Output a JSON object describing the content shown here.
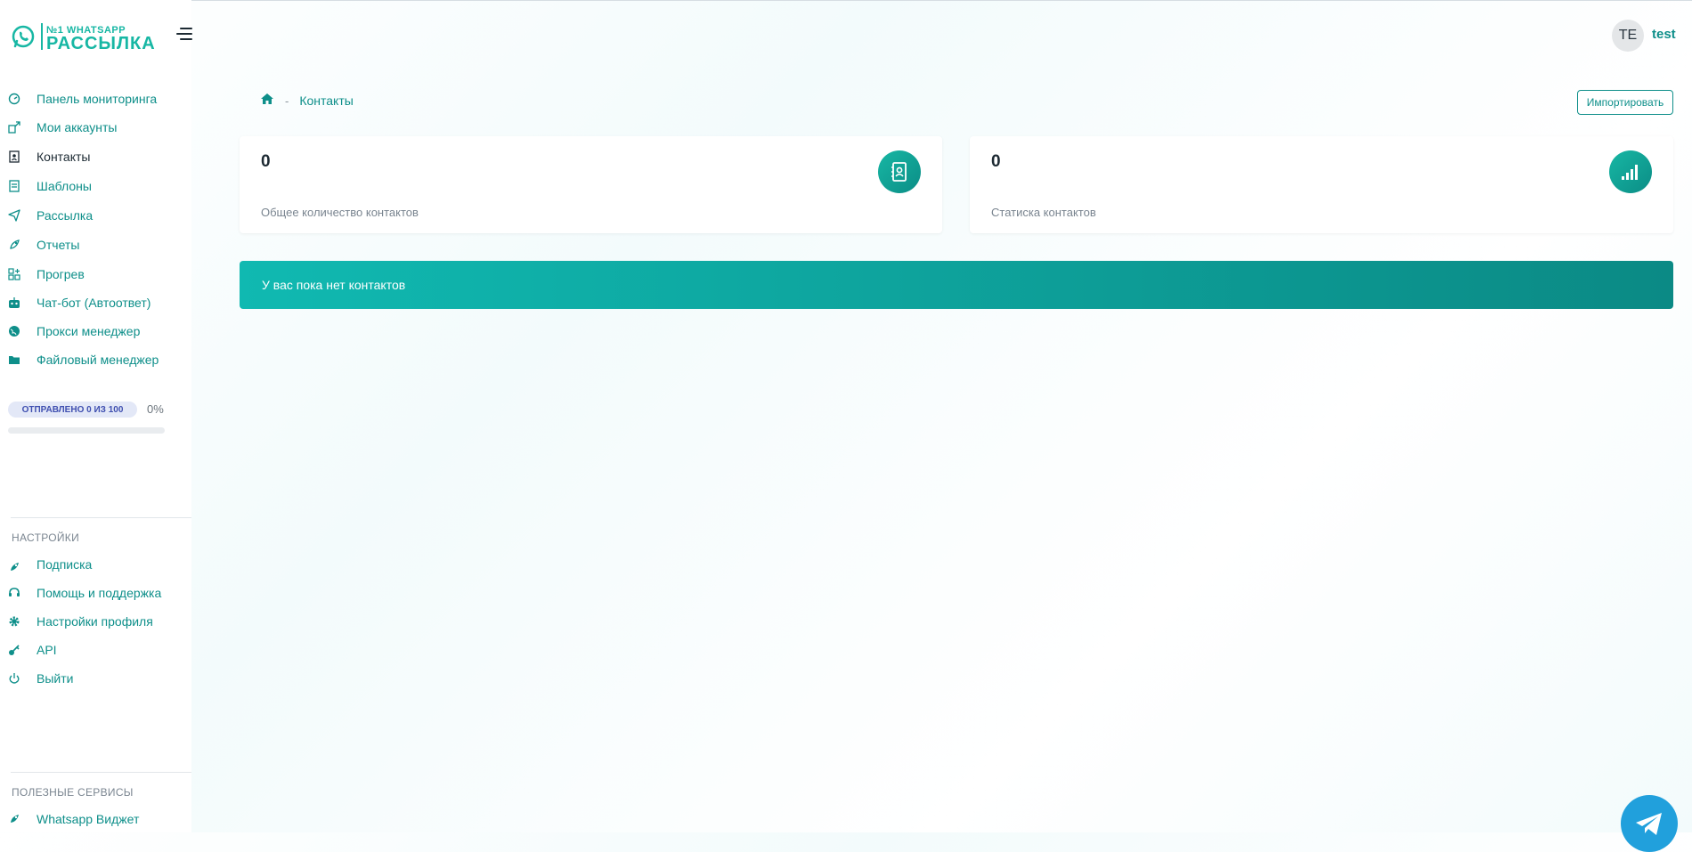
{
  "app": {
    "logo_top": "№1 WHATSAPP",
    "logo_main": "РАССЫЛКА"
  },
  "user": {
    "initials": "TE",
    "name": "test"
  },
  "sidebar": {
    "items": [
      {
        "label": "Панель мониторинга",
        "icon": "gauge-icon"
      },
      {
        "label": "Мои аккаунты",
        "icon": "accounts-icon"
      },
      {
        "label": "Контакты",
        "icon": "contact-book-icon"
      },
      {
        "label": "Шаблоны",
        "icon": "template-icon"
      },
      {
        "label": "Рассылка",
        "icon": "send-icon"
      },
      {
        "label": "Отчеты",
        "icon": "rocket-icon"
      },
      {
        "label": "Прогрев",
        "icon": "grid-plus-icon"
      },
      {
        "label": "Чат-бот (Автоответ)",
        "icon": "robot-icon"
      },
      {
        "label": "Прокси менеджер",
        "icon": "globe-icon"
      },
      {
        "label": "Файловый менеджер",
        "icon": "folder-icon"
      }
    ],
    "sent_badge": "ОТПРАВЛЕНО 0 ИЗ 100",
    "sent_percent": "0%",
    "sent_progress": 0,
    "settings_title": "НАСТРОЙКИ",
    "settings_items": [
      {
        "label": "Подписка",
        "icon": "rocket-icon"
      },
      {
        "label": "Помощь и поддержка",
        "icon": "headset-icon"
      },
      {
        "label": "Настройки профиля",
        "icon": "gear-icon"
      },
      {
        "label": "API",
        "icon": "key-icon"
      },
      {
        "label": "Выйти",
        "icon": "power-icon"
      }
    ],
    "services_title": "ПОЛЕЗНЫЕ СЕРВИСЫ",
    "services_items": [
      {
        "label": "Whatsapp Виджет",
        "icon": "rocket-icon"
      }
    ]
  },
  "breadcrumb": {
    "current": "Контакты",
    "separator": "-"
  },
  "import_button": "Импортировать",
  "cards": [
    {
      "value": "0",
      "label": "Общее количество контактов",
      "icon": "contact-book-icon"
    },
    {
      "value": "0",
      "label": "Статиска контактов",
      "icon": "signal-bars-icon"
    }
  ],
  "alert": "У вас пока нет контактов",
  "colors": {
    "accent": "#0e8f8a",
    "accent_light": "#17b7a4",
    "telegram": "#21a0dc"
  }
}
